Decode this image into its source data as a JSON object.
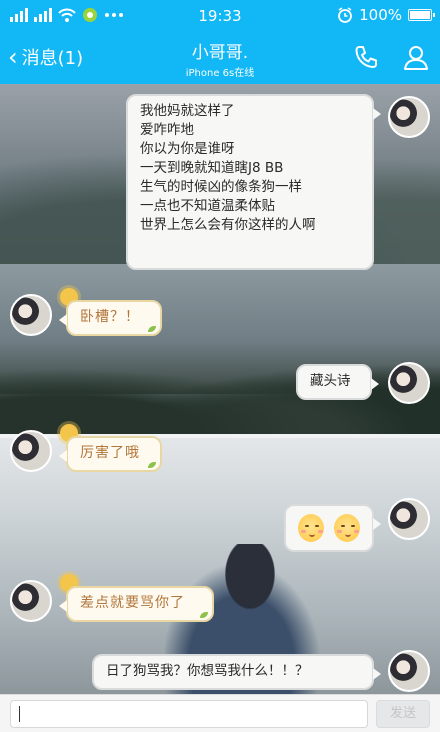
{
  "colors": {
    "brand_blue": "#12b7f5",
    "left_bubble_text": "#b2763a",
    "right_bubble_bg": "#f7f7f5"
  },
  "status_bar": {
    "time": "19:33",
    "battery": "100%",
    "icons": [
      "signal-icon",
      "signal-icon",
      "wifi-icon",
      "app-notification-icon",
      "more-dots-icon",
      "alarm-clock-icon",
      "battery-icon"
    ]
  },
  "nav_bar": {
    "back_label": "消息(1)",
    "back_chevron": "‹",
    "contact_name": "小哥哥.",
    "contact_status": "iPhone 6s在线",
    "icons": [
      "phone-icon",
      "profile-icon"
    ]
  },
  "messages": [
    {
      "side": "right",
      "lines": [
        "我他妈就这样了",
        "爱咋咋地",
        "你以为你是谁呀",
        "一天到晚就知道瞎J8 BB",
        "生气的时候凶的像条狗一样",
        "一点也不知道温柔体贴",
        "世界上怎么会有你这样的人啊"
      ]
    },
    {
      "side": "left",
      "text": "卧槽？！"
    },
    {
      "side": "right",
      "text": "藏头诗"
    },
    {
      "side": "left",
      "text": "厉害了哦"
    },
    {
      "side": "right",
      "emoji": [
        "blushing-face-icon",
        "blushing-face-icon"
      ]
    },
    {
      "side": "left",
      "text": "差点就要骂你了"
    },
    {
      "side": "right",
      "text": "日了狗骂我？你想骂我什么！！？"
    }
  ],
  "input": {
    "value": "",
    "send_label": "发送"
  }
}
